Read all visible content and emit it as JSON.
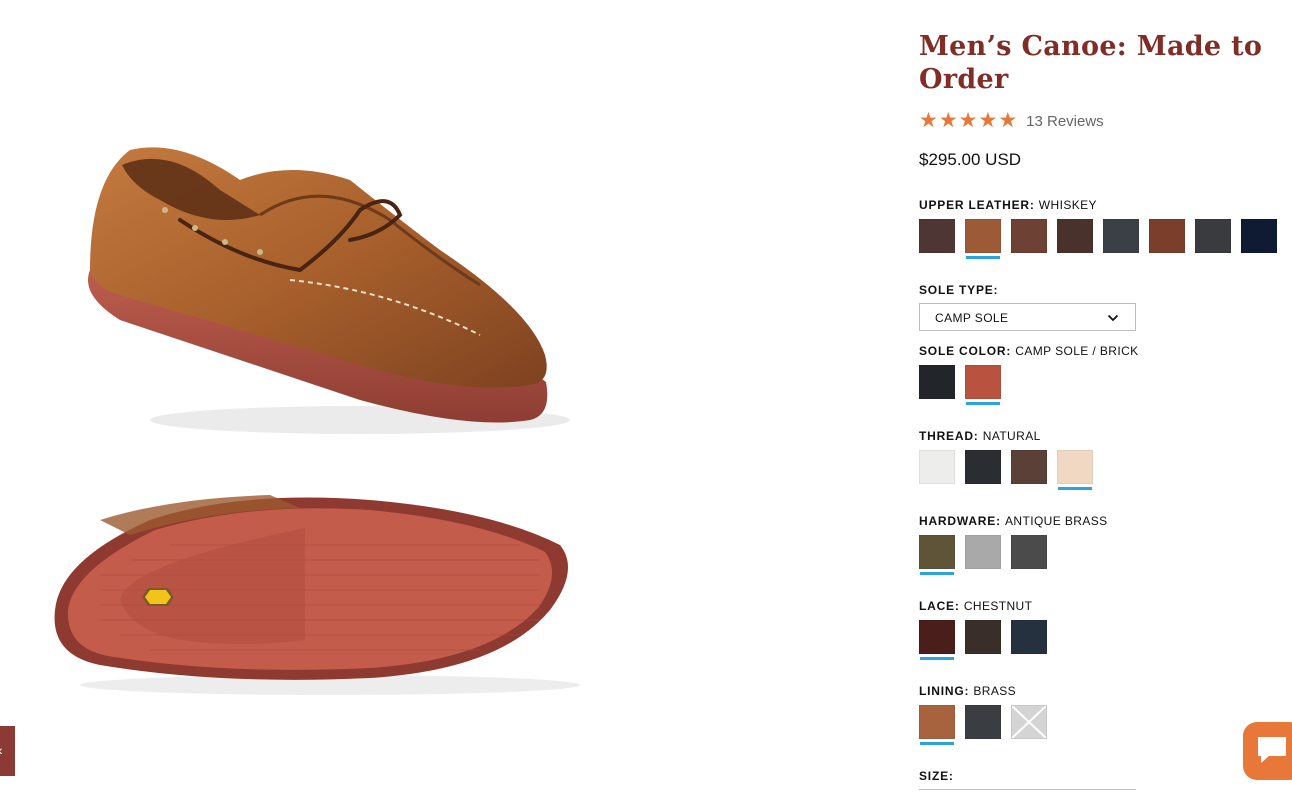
{
  "product": {
    "title": "Men’s Canoe: Made to Order",
    "rating": 5,
    "reviews_label": "13 Reviews",
    "price": "$295.00 USD"
  },
  "options": {
    "upper_leather": {
      "label": "UPPER LEATHER:",
      "value": "WHISKEY",
      "selected_index": 1,
      "swatches": [
        "#4e3634",
        "#9c5a37",
        "#6d4234",
        "#4a322c",
        "#3b4046",
        "#7a3f2b",
        "#3a3b3e",
        "#0f1a33"
      ]
    },
    "sole_type": {
      "label": "SOLE TYPE:",
      "value": "CAMP SOLE"
    },
    "sole_color": {
      "label": "SOLE COLOR:",
      "value": "CAMP SOLE / BRICK",
      "selected_index": 1,
      "swatches": [
        "#22262a",
        "#b8533f"
      ]
    },
    "thread": {
      "label": "THREAD:",
      "value": "NATURAL",
      "selected_index": 3,
      "swatches": [
        "#ededeb",
        "#2a2d31",
        "#5a4036",
        "#f0d9c3"
      ]
    },
    "hardware": {
      "label": "HARDWARE:",
      "value": "ANTIQUE BRASS",
      "selected_index": 0,
      "swatches": [
        "#5e5438",
        "#a9a9a9",
        "#4b4b4b"
      ]
    },
    "lace": {
      "label": "LACE:",
      "value": "CHESTNUT",
      "selected_index": 0,
      "swatches": [
        "#4a1e1b",
        "#3a2e2a",
        "#263140"
      ]
    },
    "lining": {
      "label": "LINING:",
      "value": "BRASS",
      "selected_index": 0,
      "swatches": [
        "#a6633e",
        "#3a3d42",
        "#d4d4d4"
      ]
    },
    "size": {
      "label": "SIZE:"
    }
  },
  "colors": {
    "title": "#7f2d26",
    "star": "#e8773a",
    "selected_underline": "#2ba3e0",
    "chat": "#e8773a"
  },
  "icons": {
    "left_tab": "chevron-left-icon",
    "chat": "chat-bubble-icon",
    "select": "chevron-down-icon"
  },
  "left_tab_glyph": "‹"
}
